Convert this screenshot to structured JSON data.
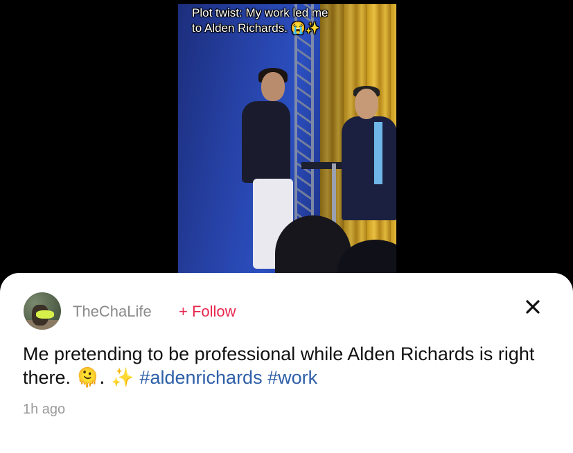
{
  "video": {
    "caption_line1": "Plot twist: My work led me",
    "caption_line2": "to Alden Richards. 😭✨"
  },
  "post": {
    "username": "TheChaLife",
    "follow_label": "+ Follow",
    "text": "Me pretending to be professional while Alden Richards is right there. ",
    "emoji": "🫠. ✨",
    "hashtags": [
      "#aldenrichards",
      "#work"
    ],
    "timestamp": "1h ago"
  },
  "colors": {
    "follow": "#e6284e",
    "hashtag": "#2e5fa8",
    "username": "#8a8a8a"
  },
  "icons": {
    "close": "close-icon",
    "avatar": "avatar"
  }
}
